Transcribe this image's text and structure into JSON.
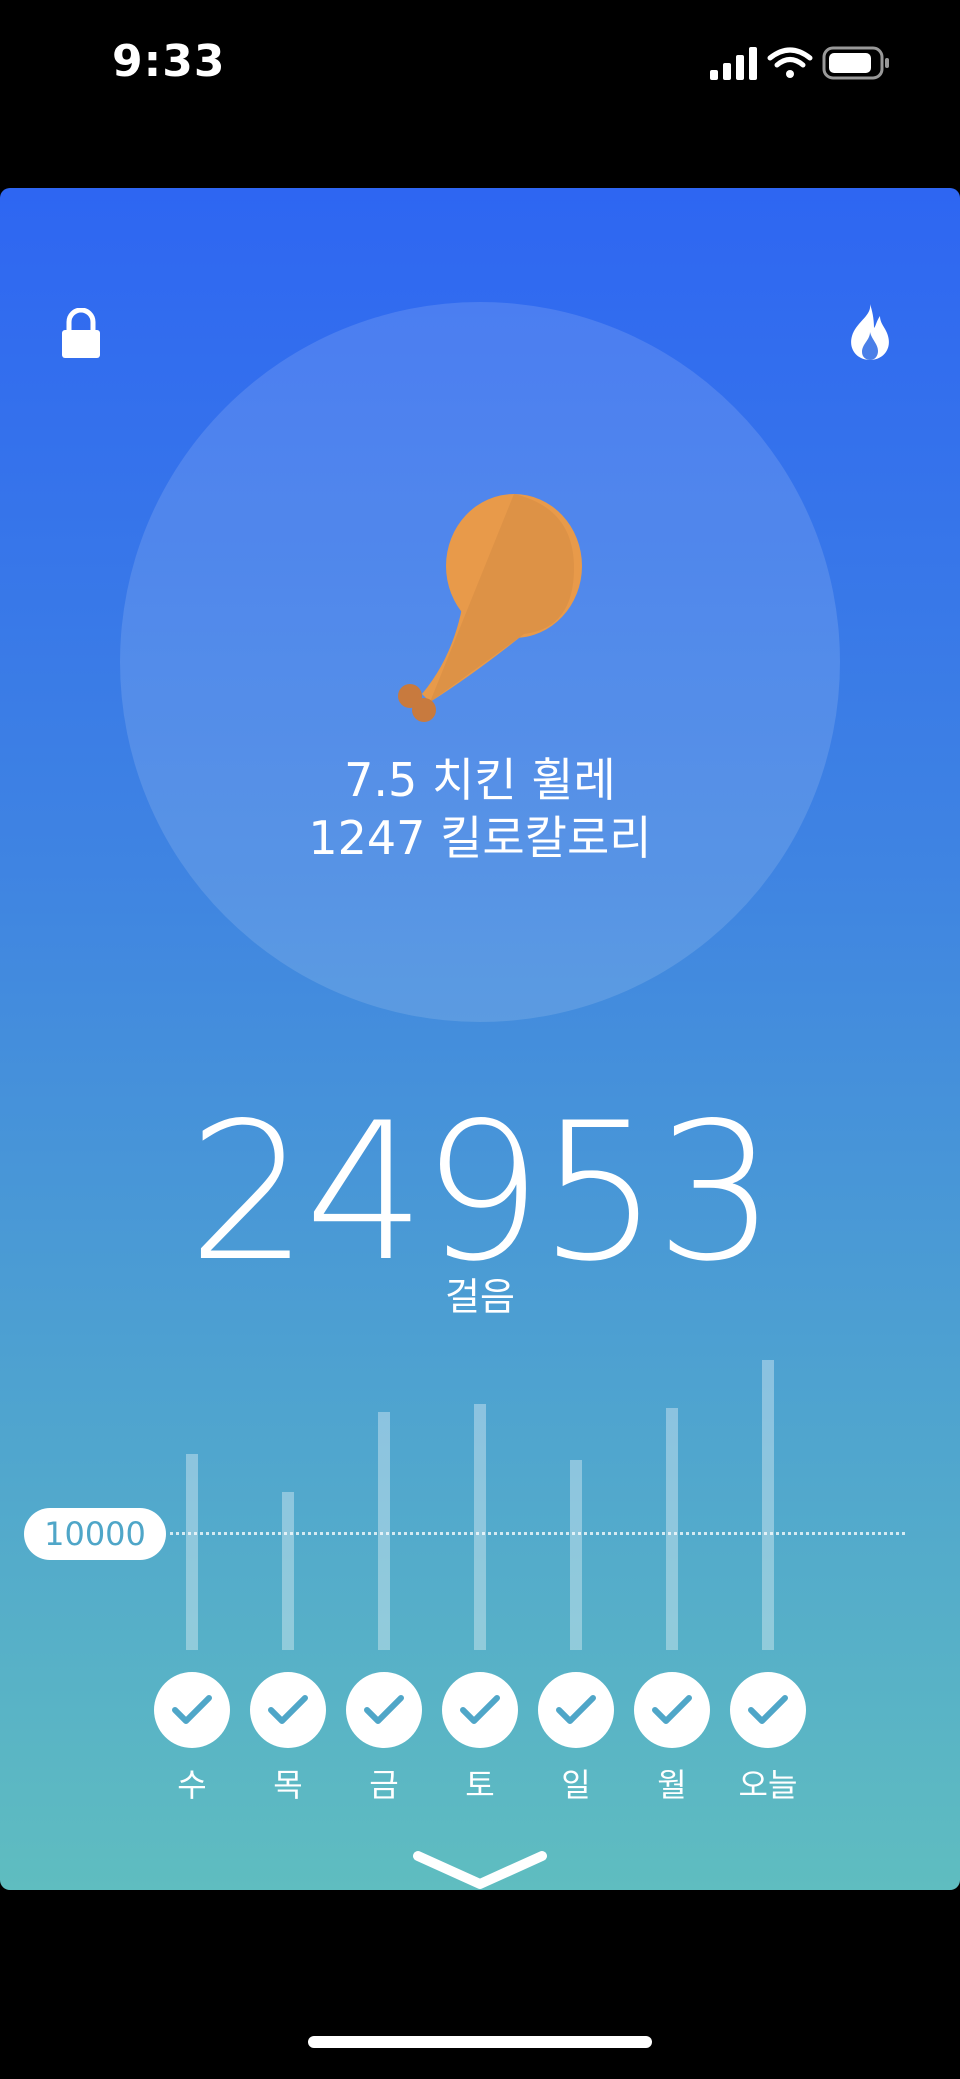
{
  "status_bar": {
    "time": "9:33",
    "icons": [
      "cellular-signal-icon",
      "wifi-icon",
      "battery-icon"
    ]
  },
  "header": {
    "left_icon": "lock-icon",
    "right_icon": "flame-icon"
  },
  "food": {
    "icon": "chicken-drumstick-icon",
    "line1": "7.5 치킨 휠레",
    "line2": "1247 킬로칼로리"
  },
  "steps": {
    "count": "24953",
    "label": "걸음"
  },
  "goal": {
    "value": "10000"
  },
  "week": {
    "days": [
      {
        "label": "수",
        "completed": true
      },
      {
        "label": "목",
        "completed": true
      },
      {
        "label": "금",
        "completed": true
      },
      {
        "label": "토",
        "completed": true
      },
      {
        "label": "일",
        "completed": true
      },
      {
        "label": "월",
        "completed": true
      },
      {
        "label": "오늘",
        "completed": true
      }
    ]
  },
  "footer": {
    "icon": "chevron-down-icon"
  },
  "colors": {
    "gradient_top": "#2e66f2",
    "gradient_bottom": "#5fbdc0",
    "drumstick": "#e89a4a",
    "check_color": "#4fa6c8"
  }
}
